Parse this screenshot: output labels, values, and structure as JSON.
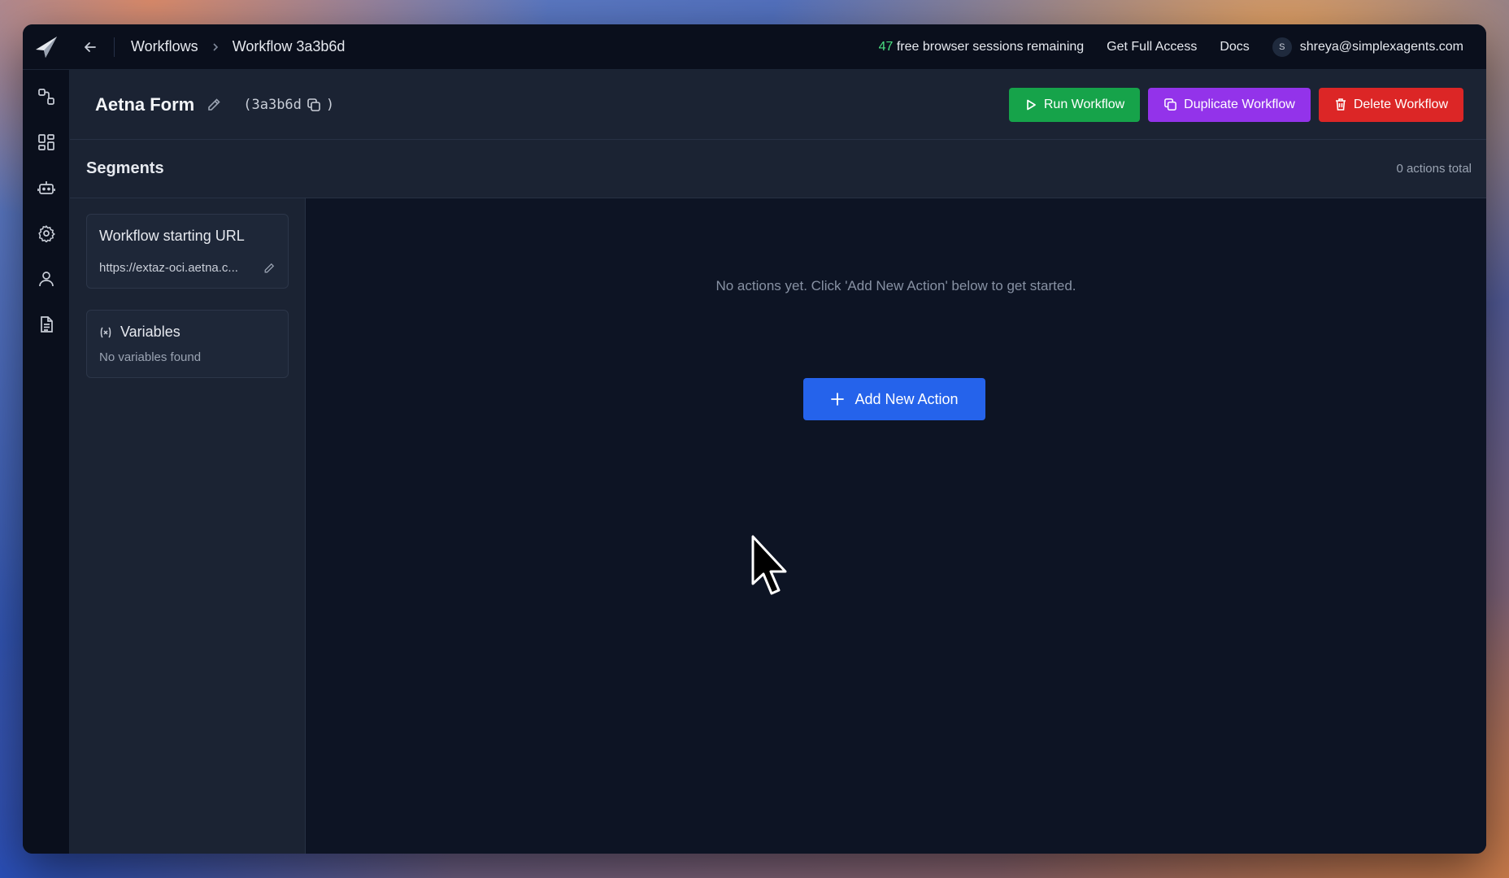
{
  "topbar": {
    "breadcrumbs": [
      "Workflows",
      "Workflow 3a3b6d"
    ],
    "sessions_count": "47",
    "sessions_text": "free browser sessions remaining",
    "get_full_access": "Get Full Access",
    "docs": "Docs",
    "user_initial": "S",
    "user_email": "shreya@simplexagents.com"
  },
  "header": {
    "title": "Aetna Form",
    "id_open": "(3a3b6d",
    "id_close": ")",
    "run_label": "Run Workflow",
    "duplicate_label": "Duplicate Workflow",
    "delete_label": "Delete Workflow"
  },
  "segments": {
    "title": "Segments",
    "count": "0 actions total"
  },
  "left": {
    "url_card_title": "Workflow starting URL",
    "url_value": "https://extaz-oci.aetna.c...",
    "variables_title": "Variables",
    "variables_empty": "No variables found"
  },
  "main": {
    "empty_text": "No actions yet. Click 'Add New Action' below to get started.",
    "add_label": "Add New Action"
  },
  "colors": {
    "run": "#16a34a",
    "duplicate": "#9333ea",
    "delete": "#dc2626",
    "add": "#2563eb",
    "sessions_count": "#4ade80"
  },
  "icons": [
    "logo-icon",
    "back-arrow-icon",
    "chevron-right-icon",
    "workflows-icon",
    "dashboard-icon",
    "bot-icon",
    "gear-icon",
    "user-icon",
    "document-icon",
    "pencil-icon",
    "copy-icon",
    "play-icon",
    "duplicate-icon",
    "trash-icon",
    "variable-icon",
    "plus-icon",
    "cursor-icon"
  ]
}
